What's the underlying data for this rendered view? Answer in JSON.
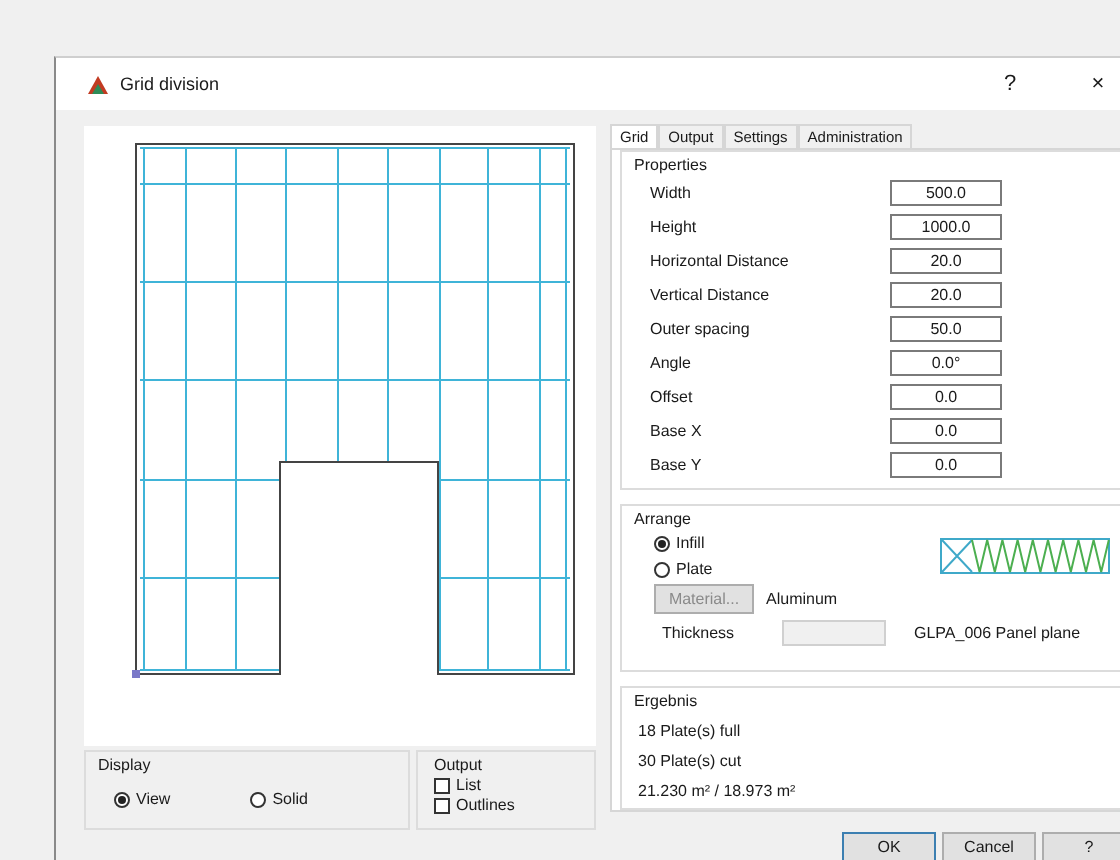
{
  "window": {
    "title": "Grid division",
    "help_glyph": "?",
    "close_glyph": "×"
  },
  "display": {
    "title": "Display",
    "options": [
      {
        "label": "View",
        "selected": true
      },
      {
        "label": "Solid",
        "selected": false
      }
    ]
  },
  "output": {
    "title": "Output",
    "options": [
      {
        "label": "List",
        "checked": false
      },
      {
        "label": "Outlines",
        "checked": false
      }
    ]
  },
  "tabs": [
    {
      "label": "Grid",
      "selected": true
    },
    {
      "label": "Output",
      "selected": false
    },
    {
      "label": "Settings",
      "selected": false
    },
    {
      "label": "Administration",
      "selected": false
    }
  ],
  "properties": {
    "title": "Properties",
    "rows": [
      {
        "label": "Width",
        "value": "500.0"
      },
      {
        "label": "Height",
        "value": "1000.0"
      },
      {
        "label": "Horizontal Distance",
        "value": "20.0"
      },
      {
        "label": "Vertical Distance",
        "value": "20.0"
      },
      {
        "label": "Outer spacing",
        "value": "50.0"
      },
      {
        "label": "Angle",
        "value": "0.0°"
      },
      {
        "label": "Offset",
        "value": "0.0"
      },
      {
        "label": "Base X",
        "value": "0.0"
      },
      {
        "label": "Base Y",
        "value": "0.0"
      }
    ]
  },
  "arrange": {
    "title": "Arrange",
    "options": [
      {
        "label": "Infill",
        "selected": true
      },
      {
        "label": "Plate",
        "selected": false
      }
    ],
    "material_button": {
      "label": "Material...",
      "disabled": true
    },
    "material": "Aluminum",
    "thickness_label": "Thickness",
    "panel": "GLPA_006 Panel plane"
  },
  "result": {
    "title": "Ergebnis",
    "lines": [
      "18 Plate(s) full",
      "30 Plate(s) cut",
      "21.230 m² / 18.973 m²"
    ]
  },
  "buttons": [
    "OK",
    "Cancel",
    "?"
  ]
}
